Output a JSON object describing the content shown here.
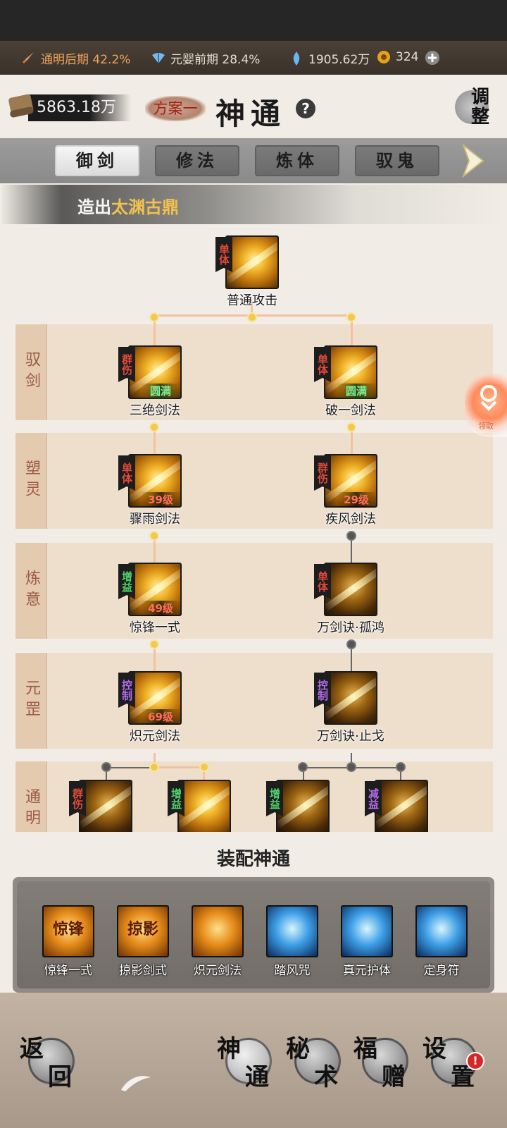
{
  "resources": [
    {
      "icon": "sword-icon",
      "text": "通明后期 42.2%",
      "color": "#f0a35c"
    },
    {
      "icon": "fan-icon",
      "text": "元婴前期 28.4%",
      "color": "#e7ded2"
    },
    {
      "icon": "crystal-icon",
      "text": "1905.62万",
      "color": "#e7ded2"
    },
    {
      "icon": "coin-icon",
      "text": "324",
      "color": "#e7ded2"
    }
  ],
  "header": {
    "power": "5863.18万",
    "scheme": "方案一",
    "title": "神通",
    "help": "?",
    "adjust": "调整"
  },
  "tabs": [
    {
      "label": "御剑",
      "active": true
    },
    {
      "label": "修法",
      "active": false
    },
    {
      "label": "炼体",
      "active": false
    },
    {
      "label": "驭鬼",
      "active": false
    }
  ],
  "banner": {
    "prefix": "造出",
    "highlight": "太渊古鼎"
  },
  "rows": [
    {
      "label": "驭剑"
    },
    {
      "label": "塑灵"
    },
    {
      "label": "炼意"
    },
    {
      "label": "元罡"
    },
    {
      "label": "通明"
    }
  ],
  "skills": {
    "root": {
      "tag": "单体",
      "name": "普通攻击"
    },
    "sanjue": {
      "tag": "群伤",
      "name": "三绝剑法",
      "badge": "圆满"
    },
    "poyi": {
      "tag": "单体",
      "name": "破一剑法",
      "badge": "圆满"
    },
    "zhouyu": {
      "tag": "单体",
      "name": "骤雨剑法",
      "badge": "39级"
    },
    "jifeng": {
      "tag": "群伤",
      "name": "疾风剑法",
      "badge": "29级"
    },
    "jingfeng": {
      "tag": "增益",
      "name": "惊锋一式",
      "badge": "49级"
    },
    "guhong": {
      "tag": "单体",
      "name": "万剑诀·孤鸿"
    },
    "chiyuan": {
      "tag": "控制",
      "name": "炽元剑法",
      "badge": "69级"
    },
    "zhige": {
      "tag": "控制",
      "name": "万剑诀·止戈"
    },
    "t1": {
      "tag": "群伤"
    },
    "t2": {
      "tag": "增益"
    },
    "t3": {
      "tag": "增益"
    },
    "t4": {
      "tag": "减益"
    }
  },
  "float_button": {
    "label": "领取"
  },
  "equip": {
    "title": "装配神通",
    "slots": [
      {
        "name": "惊锋一式",
        "glyph": "惊锋",
        "style": "gold"
      },
      {
        "name": "掠影剑式",
        "glyph": "掠影",
        "style": "gold"
      },
      {
        "name": "炽元剑法",
        "glyph": "",
        "style": "gold"
      },
      {
        "name": "踏风咒",
        "glyph": "",
        "style": "blue"
      },
      {
        "name": "真元护体",
        "glyph": "",
        "style": "blue"
      },
      {
        "name": "定身符",
        "glyph": "",
        "style": "blue"
      }
    ]
  },
  "nav": {
    "back": {
      "l1": "返",
      "l2": "回"
    },
    "shentong": {
      "l1": "神",
      "l2": "通"
    },
    "mishu": {
      "l1": "秘",
      "l2": "术"
    },
    "fuzeng": {
      "l1": "福",
      "l2": "赠"
    },
    "settings": {
      "l1": "设",
      "l2": "置"
    },
    "alert": "!"
  }
}
